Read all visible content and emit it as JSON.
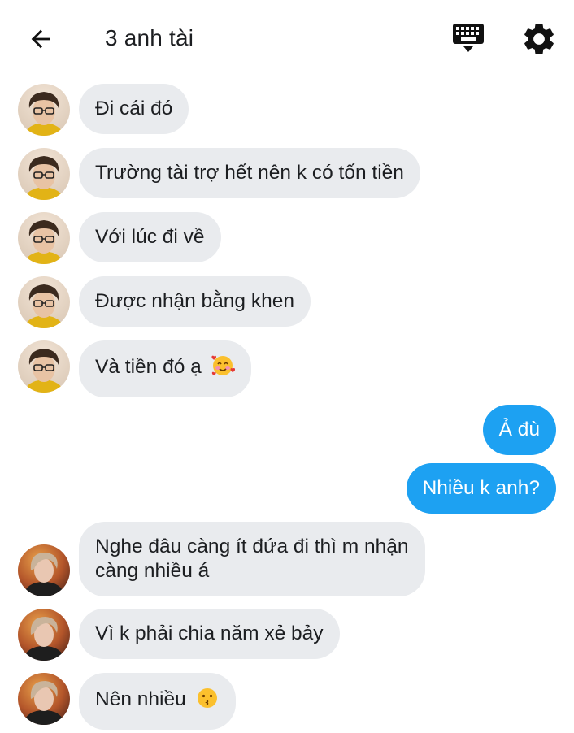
{
  "header": {
    "title": "3 anh tài",
    "back_icon": "back-arrow-icon",
    "keyboard_icon": "keyboard-icon",
    "settings_icon": "gear-icon"
  },
  "messages": [
    {
      "sender": "person-a",
      "text": "Đi cái đó"
    },
    {
      "sender": "person-a",
      "text": "Trường tài trợ hết nên k có tốn tiền"
    },
    {
      "sender": "person-a",
      "text": "Với lúc đi về"
    },
    {
      "sender": "person-a",
      "text": "Được nhận bằng khen"
    },
    {
      "sender": "person-a",
      "text": "Và tiền đó ạ",
      "emoji": "smiling-face-with-hearts"
    },
    {
      "sender": "me",
      "text": "Ả đù"
    },
    {
      "sender": "me",
      "text": "Nhiều k anh?"
    },
    {
      "sender": "person-b",
      "text_line1": "Nghe đâu càng ít đứa đi thì m nhận",
      "text_line2": "càng nhiều á"
    },
    {
      "sender": "person-b",
      "text": "Vì k phải chia năm xẻ bảy"
    },
    {
      "sender": "person-b",
      "text": "Nên nhiều",
      "emoji": "kissing-face"
    }
  ],
  "colors": {
    "incoming_bubble": "#e9ebee",
    "outgoing_bubble": "#1da1f2",
    "text": "#1c1e21"
  }
}
